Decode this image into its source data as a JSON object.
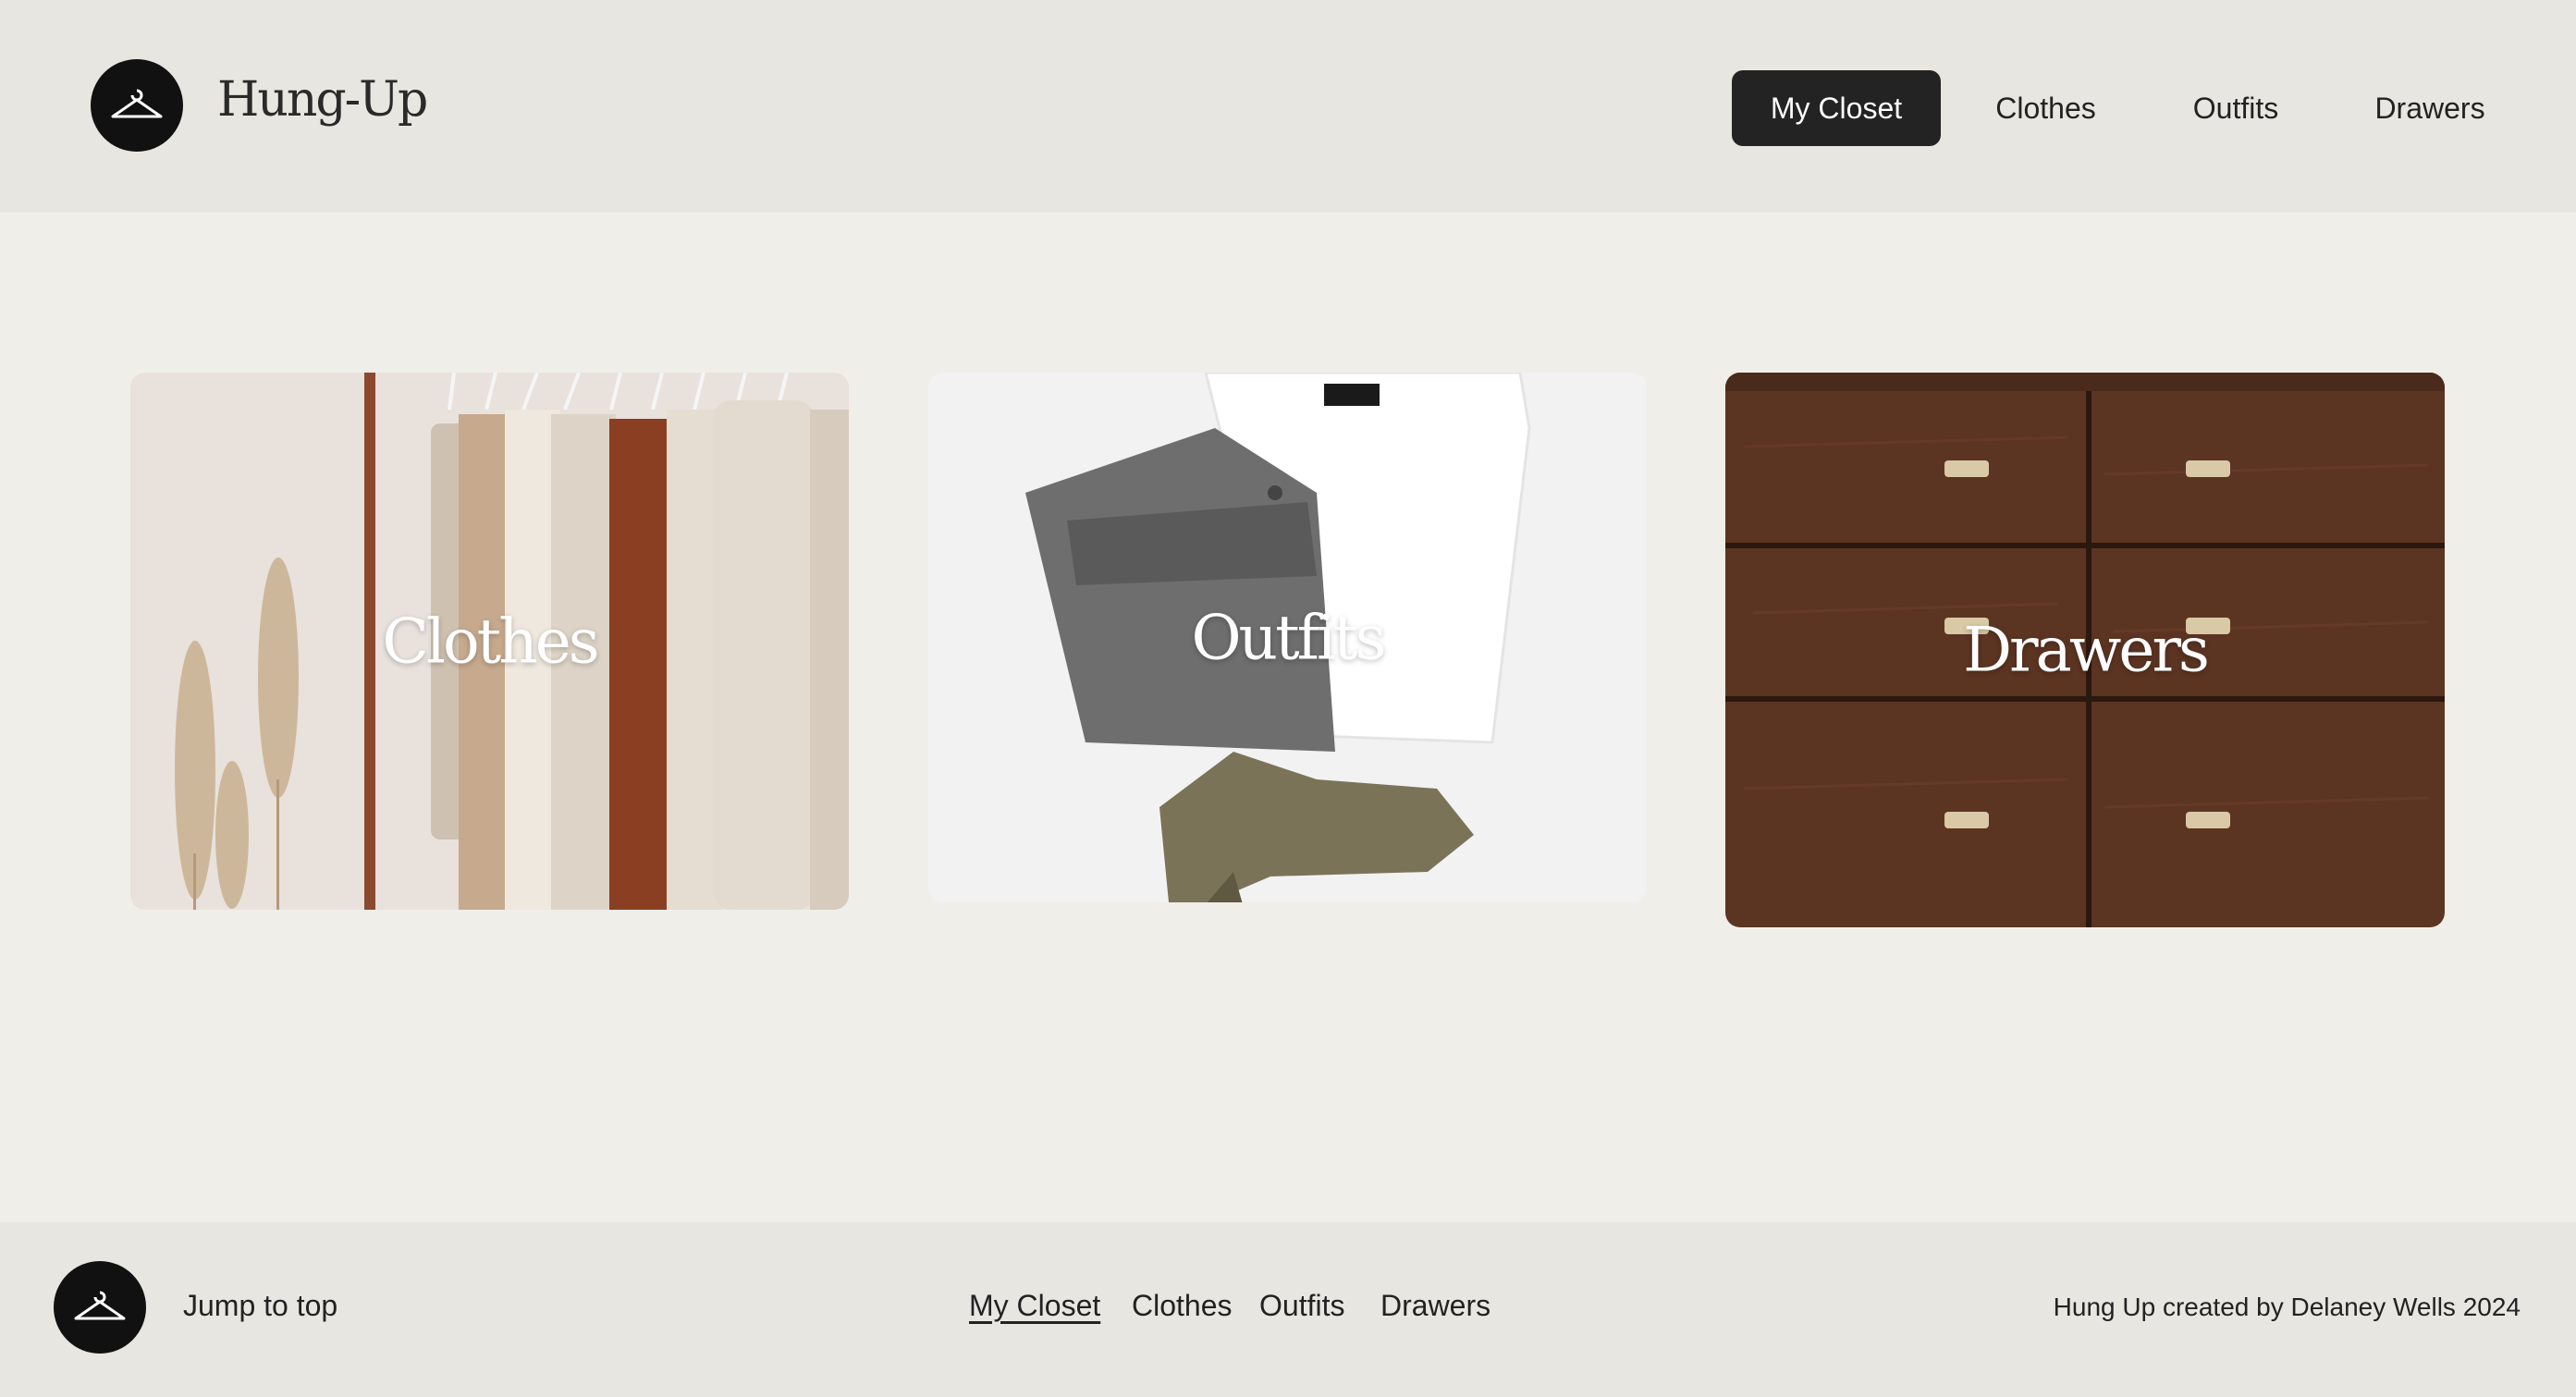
{
  "brand": {
    "name": "Hung-Up",
    "logo_icon": "hanger-icon"
  },
  "nav": {
    "items": [
      {
        "label": "My Closet",
        "active": true
      },
      {
        "label": "Clothes",
        "active": false
      },
      {
        "label": "Outfits",
        "active": false
      },
      {
        "label": "Drawers",
        "active": false
      }
    ]
  },
  "cards": [
    {
      "label": "Clothes",
      "image": "clothing-rack-photo"
    },
    {
      "label": "Outfits",
      "image": "folded-outfit-photo"
    },
    {
      "label": "Drawers",
      "image": "wooden-dresser-photo"
    }
  ],
  "footer": {
    "jump_label": "Jump to top",
    "links": [
      "My Closet",
      "Clothes",
      "Outfits",
      "Drawers"
    ],
    "credit": "Hung Up created by Delaney Wells 2024"
  },
  "colors": {
    "background": "#f0eee9",
    "bar": "#e8e6e0",
    "accent": "#232323"
  }
}
